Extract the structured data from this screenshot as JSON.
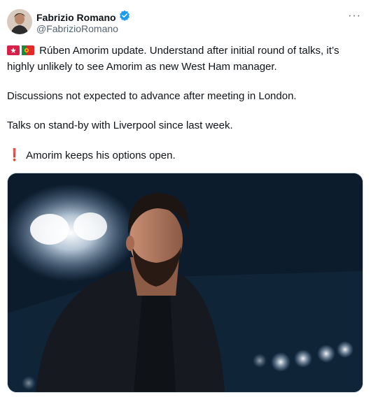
{
  "author": {
    "name": "Fabrizio Romano",
    "handle": "@FabrizioRomano"
  },
  "icons": {
    "verified": "verified-badge-icon",
    "more": "more-options-icon",
    "flag_1": "flag-icon",
    "flag_2": "portugal-flag-icon",
    "alert": "red-exclamation-icon"
  },
  "more_label": "···",
  "post": {
    "line_1": "Rúben Amorim update. Understand after initial round of talks, it’s highly unlikely to see Amorim as new West Ham manager.",
    "line_2": "Discussions not expected to advance after meeting in London.",
    "line_3": "Talks on stand-by with Liverpool since last week.",
    "line_4": "Amorim keeps his options open.",
    "alert_glyph": "❗"
  },
  "colors": {
    "verified": "#1d9bf0",
    "text": "#0f1419",
    "muted": "#536471",
    "alert": "#e0245e"
  }
}
